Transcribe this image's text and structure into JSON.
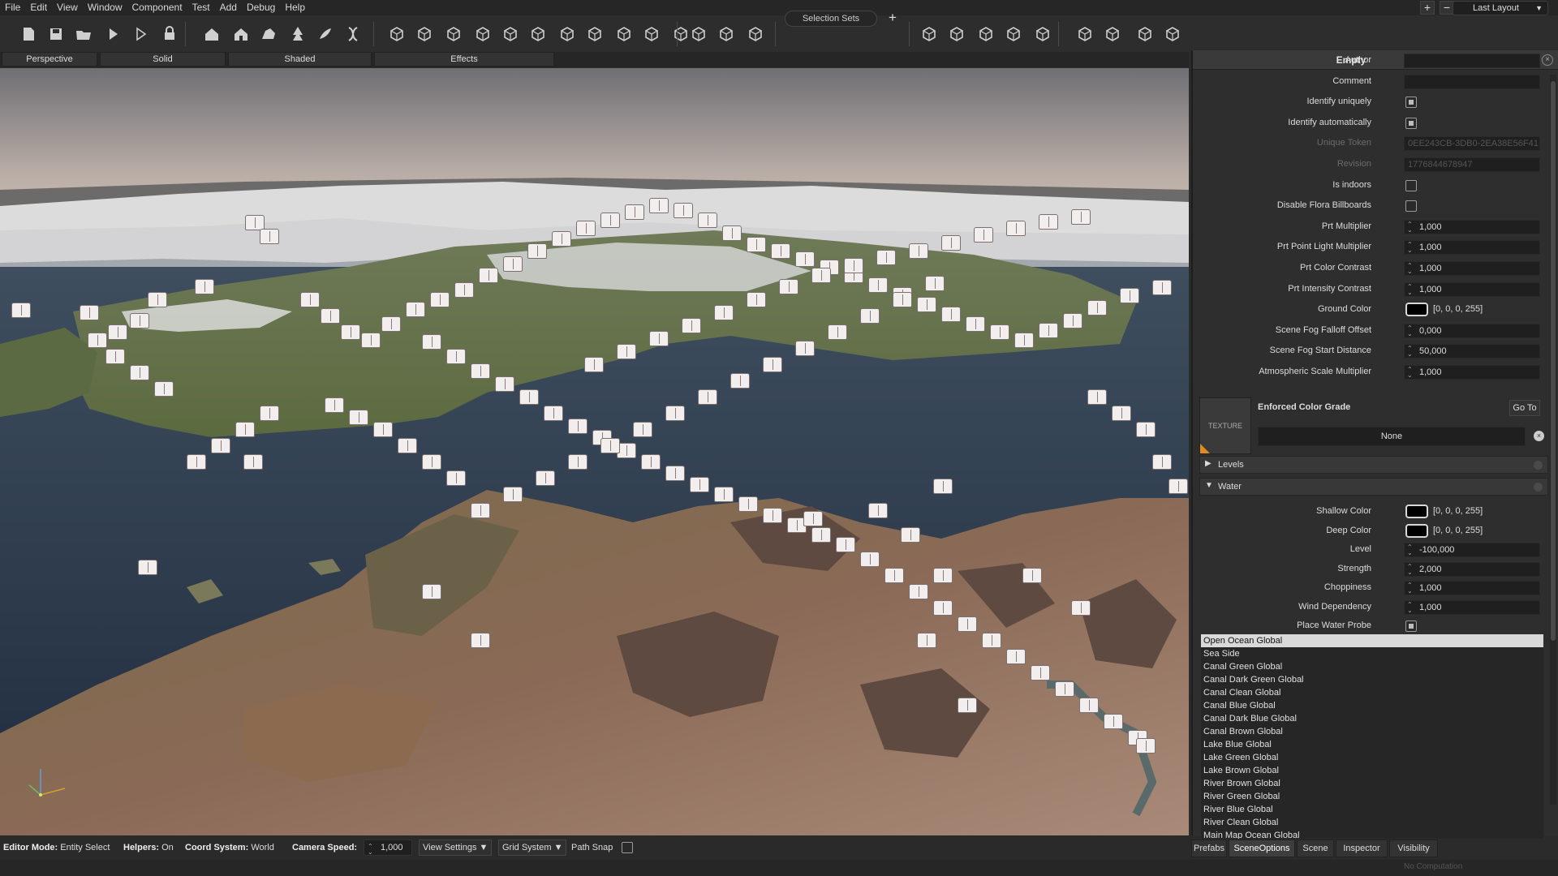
{
  "menu": [
    "File",
    "Edit",
    "View",
    "Window",
    "Component",
    "Test",
    "Add",
    "Debug",
    "Help"
  ],
  "window_controls": {
    "add": "+",
    "remove": "−"
  },
  "layout_select": "Last Layout",
  "toolbar": {
    "selection_sets": "Selection Sets",
    "selection_add": "+"
  },
  "view_tabs": [
    "Perspective",
    "Solid",
    "Shaded",
    "Effects"
  ],
  "panel": {
    "title": "Empty",
    "props_top": [
      {
        "label": "Author",
        "type": "text",
        "value": ""
      },
      {
        "label": "Comment",
        "type": "text",
        "value": ""
      },
      {
        "label": "Identify uniquely",
        "type": "check",
        "checked": true
      },
      {
        "label": "Identify automatically",
        "type": "check",
        "checked": true
      },
      {
        "label": "Unique Token",
        "type": "text-dim",
        "value": "0EE243CB-3DB0-2EA38E56F41",
        "dim": true
      },
      {
        "label": "Revision",
        "type": "text-dim",
        "value": "1776844678947",
        "dim": true
      },
      {
        "label": "Is indoors",
        "type": "check",
        "checked": false
      },
      {
        "label": "Disable Flora Billboards",
        "type": "check",
        "checked": false
      },
      {
        "label": "Prt Multiplier",
        "type": "num",
        "value": "1,000"
      },
      {
        "label": "Prt Point Light Multiplier",
        "type": "num",
        "value": "1,000"
      },
      {
        "label": "Prt Color Contrast",
        "type": "num",
        "value": "1,000"
      },
      {
        "label": "Prt Intensity Contrast",
        "type": "num",
        "value": "1,000"
      },
      {
        "label": "Ground Color",
        "type": "color",
        "value": "[0, 0, 0, 255]",
        "color": "#000000"
      },
      {
        "label": "Scene Fog Falloff Offset",
        "type": "num",
        "value": "0,000"
      },
      {
        "label": "Scene Fog Start Distance",
        "type": "num",
        "value": "50,000"
      },
      {
        "label": "Atmospheric Scale Multiplier",
        "type": "num",
        "value": "1,000"
      }
    ],
    "texture": {
      "thumb_label": "TEXTURE",
      "label": "Enforced Color Grade",
      "goto": "Go To",
      "value": "None"
    },
    "sections": {
      "levels": "Levels",
      "water": "Water"
    },
    "water_props": [
      {
        "label": "Shallow Color",
        "type": "color",
        "value": "[0, 0, 0, 255]",
        "color": "#000000"
      },
      {
        "label": "Deep Color",
        "type": "color",
        "value": "[0, 0, 0, 255]",
        "color": "#000000"
      },
      {
        "label": "Level",
        "type": "num",
        "value": "-100,000"
      },
      {
        "label": "Strength",
        "type": "num",
        "value": "2,000"
      },
      {
        "label": "Choppiness",
        "type": "num",
        "value": "1,000"
      },
      {
        "label": "Wind Dependency",
        "type": "num",
        "value": "1,000"
      },
      {
        "label": "Place Water Probe",
        "type": "check",
        "checked": true
      }
    ],
    "water_presets": [
      "Open Ocean Global",
      "Sea Side",
      "Canal Green Global",
      "Canal Dark Green Global",
      "Canal Clean Global",
      "Canal Blue Global",
      "Canal Dark Blue Global",
      "Canal Brown Global",
      "Lake Blue Global",
      "Lake Green Global",
      "Lake Brown Global",
      "River Brown Global",
      "River Green Global",
      "River Blue Global",
      "River Clean Global",
      "Main Map Ocean Global"
    ],
    "water_selected": "Open Ocean Global",
    "tabs": [
      "Prefabs",
      "SceneOptions",
      "Scene",
      "Inspector",
      "Visibility"
    ],
    "active_tab": "SceneOptions"
  },
  "status": {
    "editor_mode_label": "Editor Mode:",
    "editor_mode": "Entity Select",
    "helpers_label": "Helpers:",
    "helpers": "On",
    "coord_label": "Coord System:",
    "coord": "World",
    "camera_speed_label": "Camera Speed:",
    "camera_speed": "1,000",
    "view_settings": "View Settings ▼",
    "grid_system": "Grid System ▼",
    "path_snap": "Path Snap",
    "no_computation": "No Computation"
  },
  "icons": {
    "toolbar": [
      "new-entity-icon",
      "save-icon",
      "open-folder-icon",
      "play-icon",
      "play-outline-icon",
      "lock-icon",
      "house-icon",
      "house-variant-icon",
      "rock-icon",
      "tree-icon",
      "brush-icon",
      "dna-icon",
      "cube-icon",
      "cube-plus-icon",
      "cube-line-icon",
      "cube-move-icon",
      "cube-grid-icon",
      "gear-shape-icon",
      "cube-frame-icon",
      "cube-frame-2-icon",
      "cube-frame-3-icon",
      "cube-frame-4-icon",
      "cube-frame-5-icon",
      "pin-move-icon",
      "pin-rotate-icon",
      "pin-scale-icon",
      "terrain-icon",
      "gear-pair-icon",
      "hand-icon",
      "brain-icon",
      "gi-cube-icon",
      "package-icon",
      "ruler-icon",
      "warning-icon",
      "speaker-icon"
    ]
  },
  "colors": {
    "panel_bg": "#2e2e2e",
    "accent": "#e08a20",
    "selection": "#d9d9d9"
  }
}
